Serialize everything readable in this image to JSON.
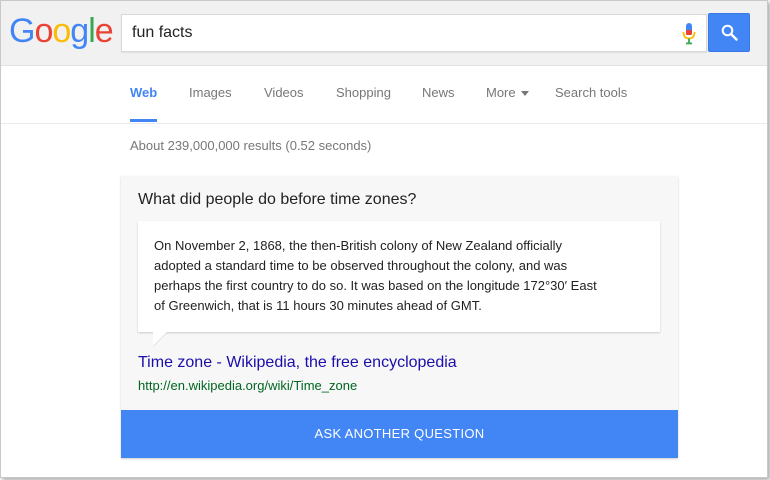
{
  "logo": {
    "letters": [
      "G",
      "o",
      "o",
      "g",
      "l",
      "e"
    ],
    "colors": [
      "#4285f4",
      "#ea4335",
      "#fbbc05",
      "#4285f4",
      "#34a853",
      "#ea4335"
    ]
  },
  "search": {
    "query": "fun facts",
    "mic_icon": "microphone-icon",
    "button_icon": "search-icon"
  },
  "nav": {
    "items": [
      {
        "label": "Web"
      },
      {
        "label": "Images"
      },
      {
        "label": "Videos"
      },
      {
        "label": "Shopping"
      },
      {
        "label": "News"
      },
      {
        "label": "More"
      },
      {
        "label": "Search tools"
      }
    ],
    "active": "Web"
  },
  "results": {
    "count_text": "About 239,000,000 results (0.52 seconds)"
  },
  "answer_card": {
    "question": "What did people do before time zones?",
    "answer_lines": [
      "On November 2, 1868, the then-British colony of New Zealand officially",
      "adopted a standard time to be observed throughout the colony, and was",
      "perhaps the first country to do so. It was based on the longitude 172°30′ East",
      "of Greenwich, that is 11 hours 30 minutes ahead of GMT."
    ],
    "source_title": "Time zone - Wikipedia, the free encyclopedia",
    "source_url": "http://en.wikipedia.org/wiki/Time_zone",
    "button_label": "ASK ANOTHER QUESTION"
  },
  "colors": {
    "accent": "#4285f4",
    "link": "#1a0dab",
    "url": "#006621"
  }
}
